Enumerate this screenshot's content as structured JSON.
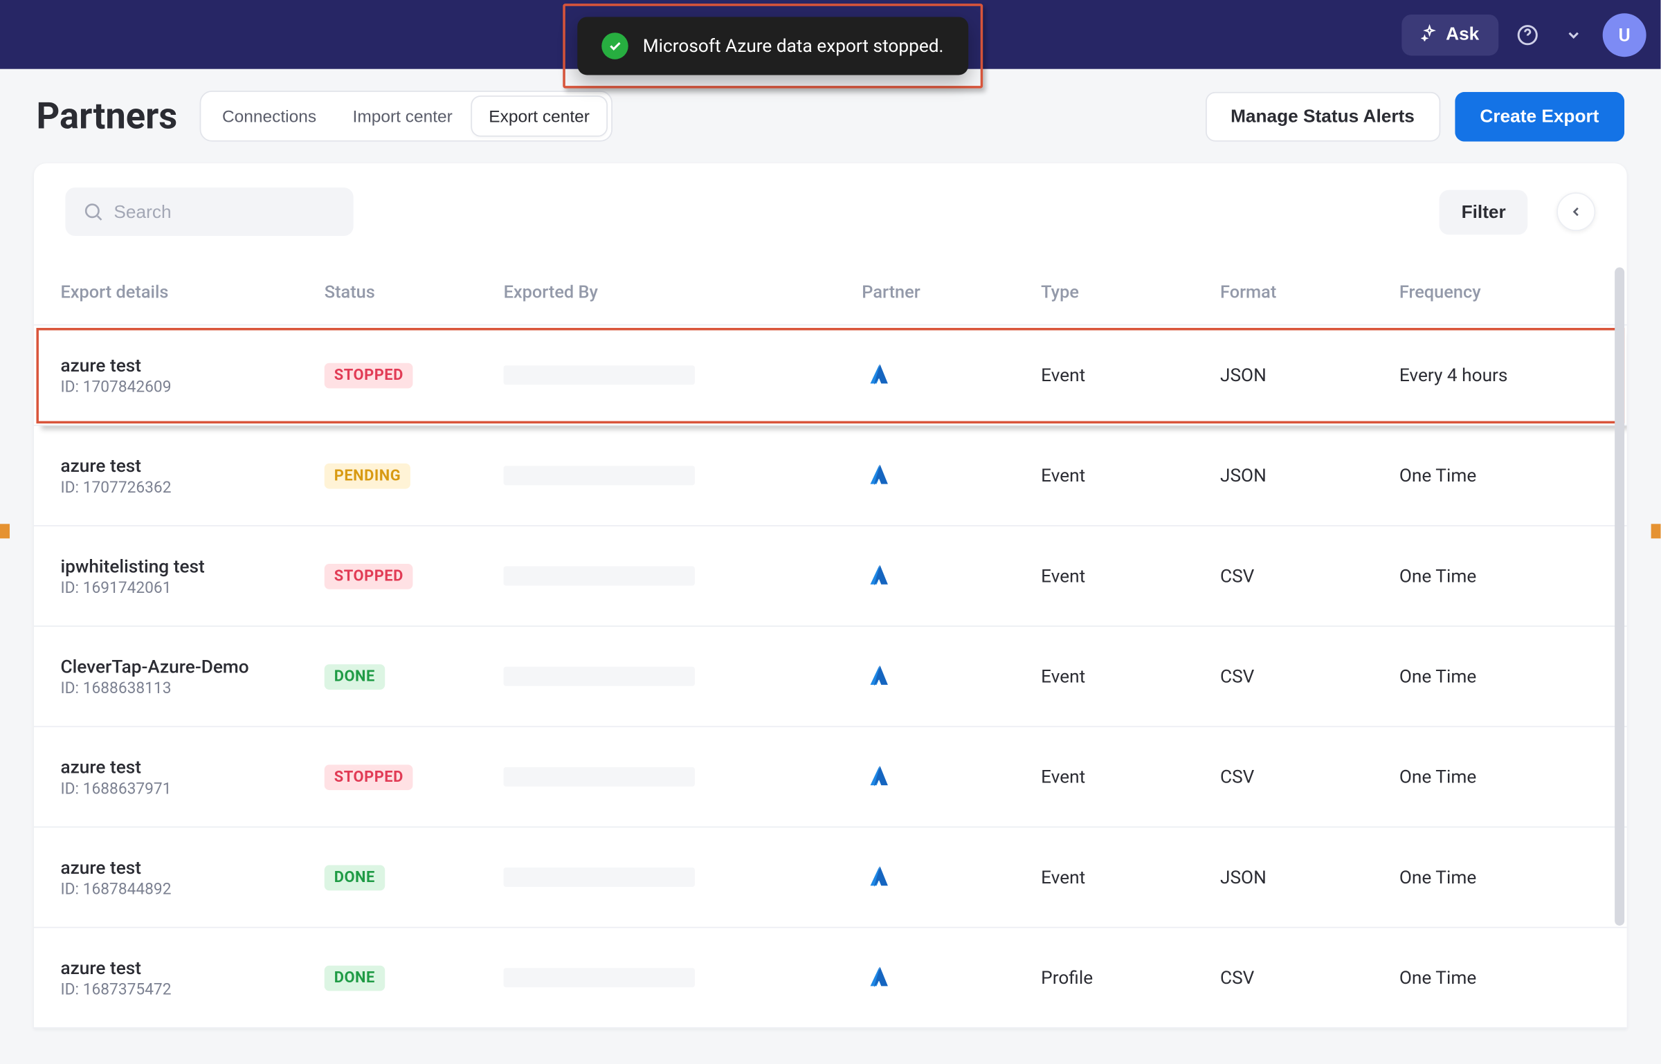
{
  "topbar": {
    "ask_label": "Ask",
    "avatar_letter": "U"
  },
  "toast": {
    "message": "Microsoft Azure data export stopped."
  },
  "page": {
    "title": "Partners",
    "tabs": [
      "Connections",
      "Import center",
      "Export center"
    ],
    "active_tab_index": 2
  },
  "actions": {
    "manage_alerts": "Manage Status Alerts",
    "create_export": "Create Export"
  },
  "search": {
    "placeholder": "Search"
  },
  "filter_label": "Filter",
  "columns": [
    "Export details",
    "Status",
    "Exported By",
    "Partner",
    "Type",
    "Format",
    "Frequency"
  ],
  "id_prefix": "ID: ",
  "rows": [
    {
      "name": "azure test",
      "id": "1707842609",
      "status": "STOPPED",
      "partner": "azure",
      "type": "Event",
      "format": "JSON",
      "frequency": "Every 4 hours",
      "highlight": true
    },
    {
      "name": "azure test",
      "id": "1707726362",
      "status": "PENDING",
      "partner": "azure",
      "type": "Event",
      "format": "JSON",
      "frequency": "One Time"
    },
    {
      "name": "ipwhitelisting test",
      "id": "1691742061",
      "status": "STOPPED",
      "partner": "azure",
      "type": "Event",
      "format": "CSV",
      "frequency": "One Time"
    },
    {
      "name": "CleverTap-Azure-Demo",
      "id": "1688638113",
      "status": "DONE",
      "partner": "azure",
      "type": "Event",
      "format": "CSV",
      "frequency": "One Time"
    },
    {
      "name": "azure test",
      "id": "1688637971",
      "status": "STOPPED",
      "partner": "azure",
      "type": "Event",
      "format": "CSV",
      "frequency": "One Time"
    },
    {
      "name": "azure test",
      "id": "1687844892",
      "status": "DONE",
      "partner": "azure",
      "type": "Event",
      "format": "JSON",
      "frequency": "One Time"
    },
    {
      "name": "azure test",
      "id": "1687375472",
      "status": "DONE",
      "partner": "azure",
      "type": "Profile",
      "format": "CSV",
      "frequency": "One Time"
    }
  ]
}
